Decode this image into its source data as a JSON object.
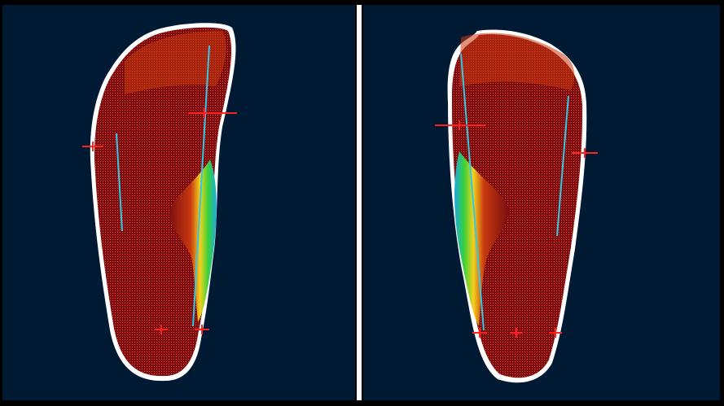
{
  "viewer": {
    "background": "#001a33",
    "divider_color": "#ffffff",
    "panels": [
      {
        "id": "left",
        "foot": "left-foot-pressure-map"
      },
      {
        "id": "right",
        "foot": "right-foot-pressure-map"
      }
    ],
    "colors": {
      "outline": "#ffffff",
      "high_pressure": "#7a0f0f",
      "mid_pressure": "#e8461a",
      "low_pressure": "#f2d21c",
      "lower_pressure": "#3ad23a",
      "lowest_pressure": "#1aa8e0",
      "axis_line": "#33c8e6",
      "marker": "#ff2020"
    }
  }
}
